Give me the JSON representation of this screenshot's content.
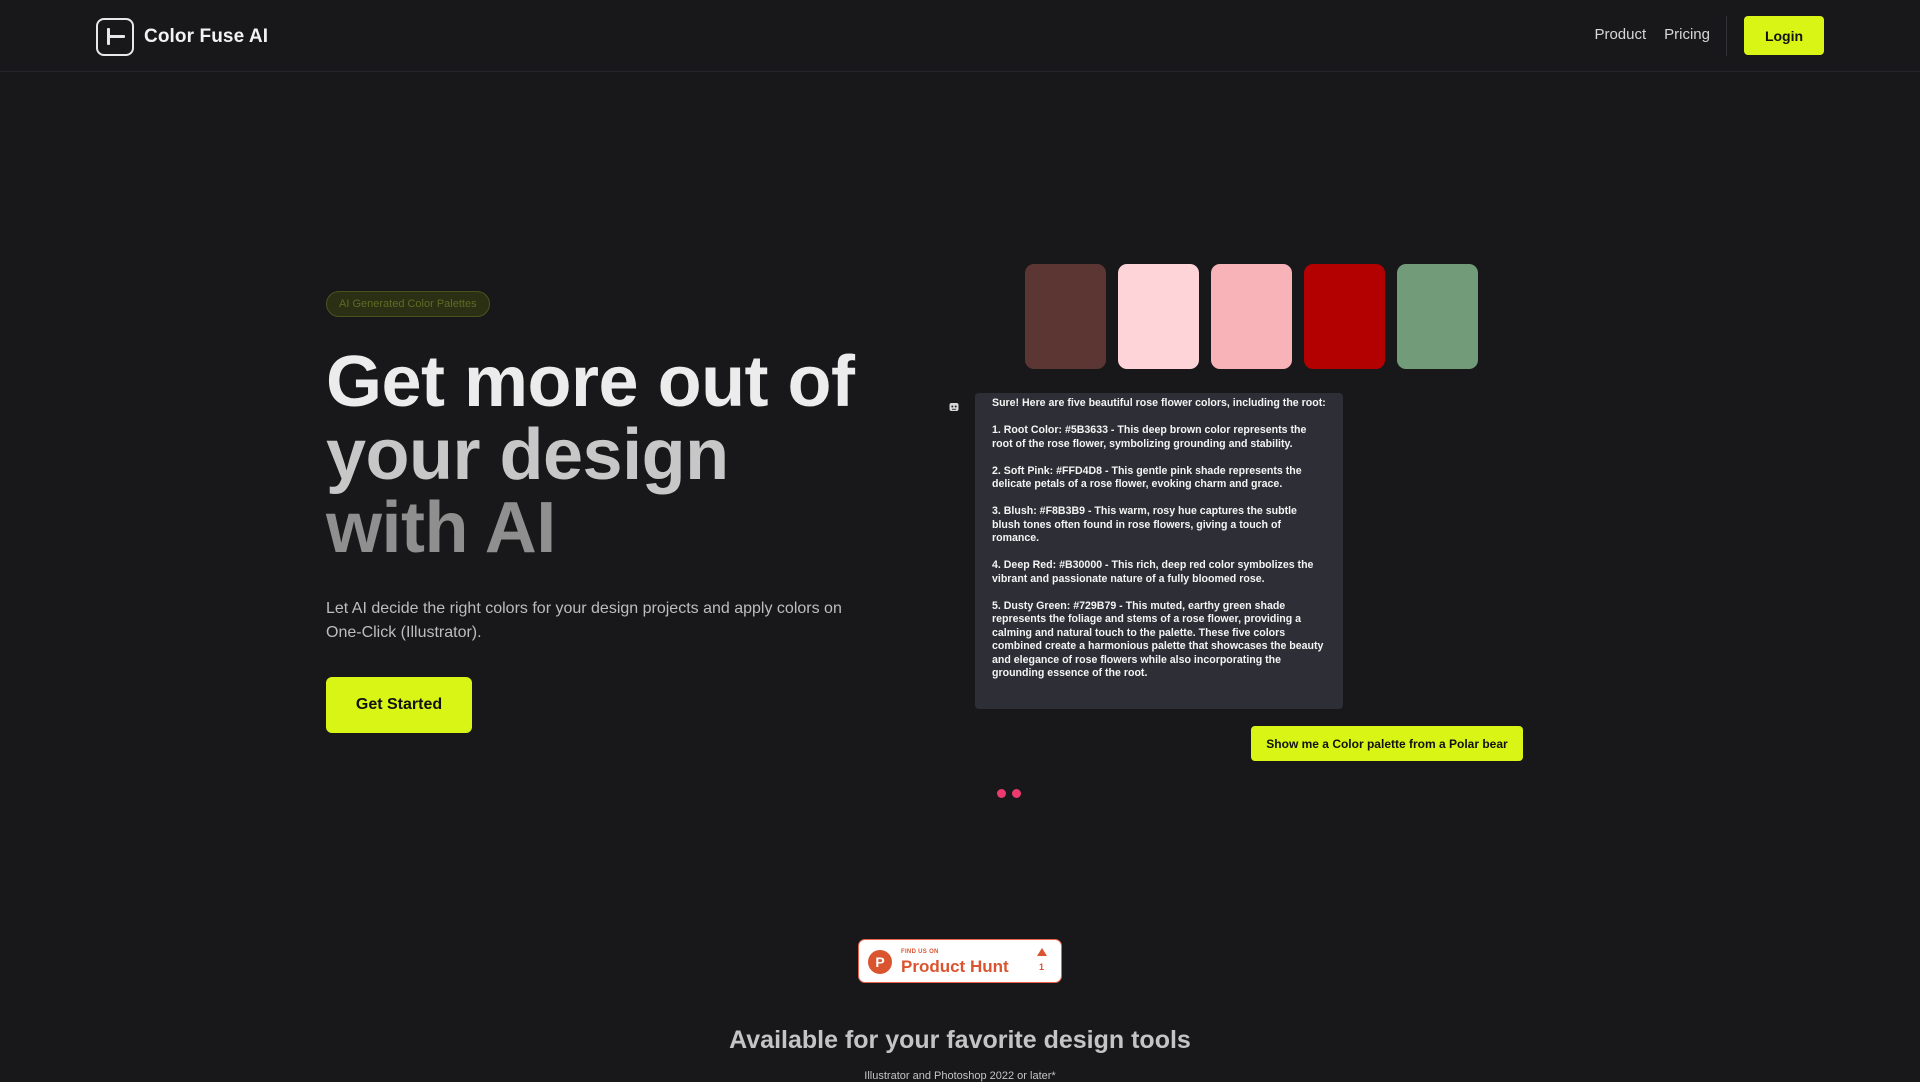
{
  "nav": {
    "brand": "Color Fuse AI",
    "links": [
      "Product",
      "Pricing"
    ],
    "login_label": "Login"
  },
  "hero": {
    "badge": "AI Generated Color Palettes",
    "title_line1": "Get more out of",
    "title_line2": "your design",
    "title_line3": "with AI",
    "subtitle": "Let AI decide the right colors for your design projects and apply colors on One-Click (Illustrator).",
    "cta_label": "Get Started"
  },
  "palette": {
    "swatches": [
      "#5B3633",
      "#FFD4D8",
      "#F8B3B9",
      "#B30000",
      "#729B79"
    ]
  },
  "chat": {
    "paragraphs": [
      "Sure! Here are five beautiful rose flower colors, including the root:",
      "1. Root Color: #5B3633 - This deep brown color represents the root of the rose flower, symbolizing grounding and stability.",
      "2. Soft Pink: #FFD4D8 - This gentle pink shade represents the delicate petals of a rose flower, evoking charm and grace.",
      "3. Blush: #F8B3B9 - This warm, rosy hue captures the subtle blush tones often found in rose flowers, giving a touch of romance.",
      "4. Deep Red: #B30000 - This rich, deep red color symbolizes the vibrant and passionate nature of a fully bloomed rose.",
      "5. Dusty Green: #729B79 - This muted, earthy green shade represents the foliage and stems of a rose flower, providing a calming and natural touch to the palette. These five colors combined create a harmonious palette that showcases the beauty and elegance of rose flowers while also incorporating the grounding essence of the root."
    ],
    "prompt_label": "Show me a Color palette from a Polar bear"
  },
  "product_hunt": {
    "small_text": "FIND US ON",
    "big_text": "Product Hunt",
    "logo_letter": "P",
    "upvotes": "1"
  },
  "bottom": {
    "title": "Available for your favorite design tools",
    "note": "Illustrator and Photoshop 2022 or later*"
  },
  "colors": {
    "accent": "#D9F515",
    "background": "#18181B",
    "dot": "#EA3A6E",
    "product_hunt": "#DA552F"
  }
}
